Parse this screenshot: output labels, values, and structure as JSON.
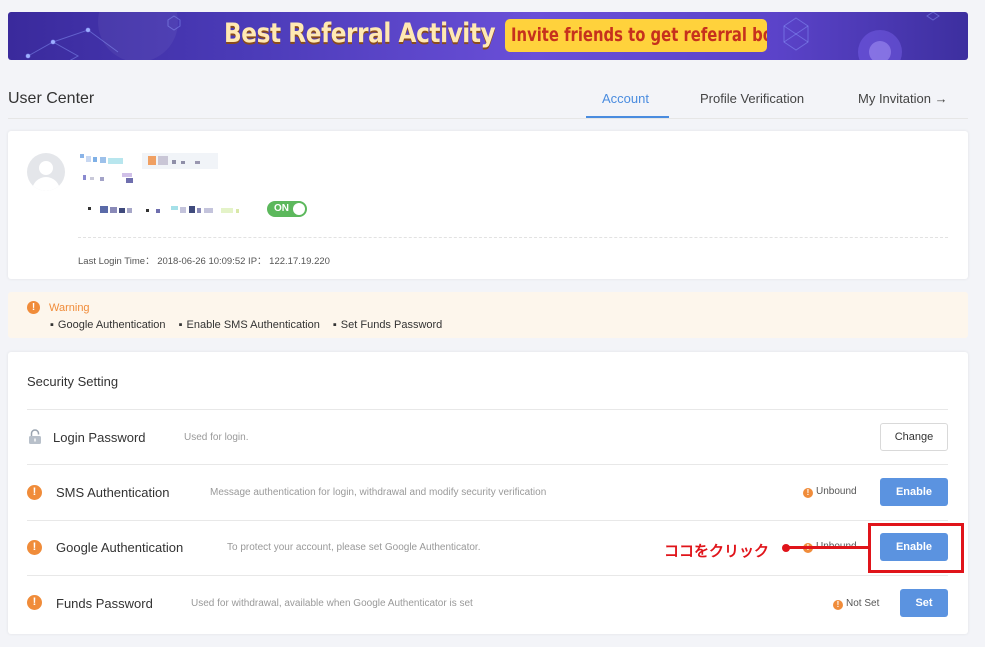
{
  "banner": {
    "title": "Best Referral Activity",
    "pill": "Invite friends to get  referral bonus"
  },
  "header": {
    "title": "User Center",
    "tabs": [
      {
        "label": "Account",
        "active": true
      },
      {
        "label": "Profile Verification",
        "active": false
      },
      {
        "label": "My Invitation →",
        "active": false
      }
    ]
  },
  "account": {
    "toggle_label": "ON",
    "login_info": "Last Login Time： 2018-06-26 10:09:52   IP： 122.17.19.220"
  },
  "warning": {
    "title": "Warning",
    "items": [
      "Google Authentication",
      "Enable SMS Authentication",
      "Set Funds Password"
    ]
  },
  "security": {
    "title": "Security Setting",
    "rows": [
      {
        "label": "Login Password",
        "desc": "Used for login.",
        "status": "",
        "button": "Change"
      },
      {
        "label": "SMS Authentication",
        "desc": "Message authentication for login, withdrawal and modify security verification",
        "status": "Unbound",
        "button": "Enable"
      },
      {
        "label": "Google Authentication",
        "desc": "To protect your account, please set Google Authenticator.",
        "status": "Unbound",
        "button": "Enable"
      },
      {
        "label": "Funds Password",
        "desc": "Used for withdrawal, available when Google Authenticator is set",
        "status": "Not Set",
        "button": "Set"
      }
    ]
  },
  "annotation": {
    "text": "ココをクリック"
  },
  "colors": {
    "accent": "#4a8cdf",
    "primary_button": "#5b93e0",
    "warning": "#f08c3a",
    "toggle_on": "#5cb85c",
    "annotation": "#e0141a"
  }
}
